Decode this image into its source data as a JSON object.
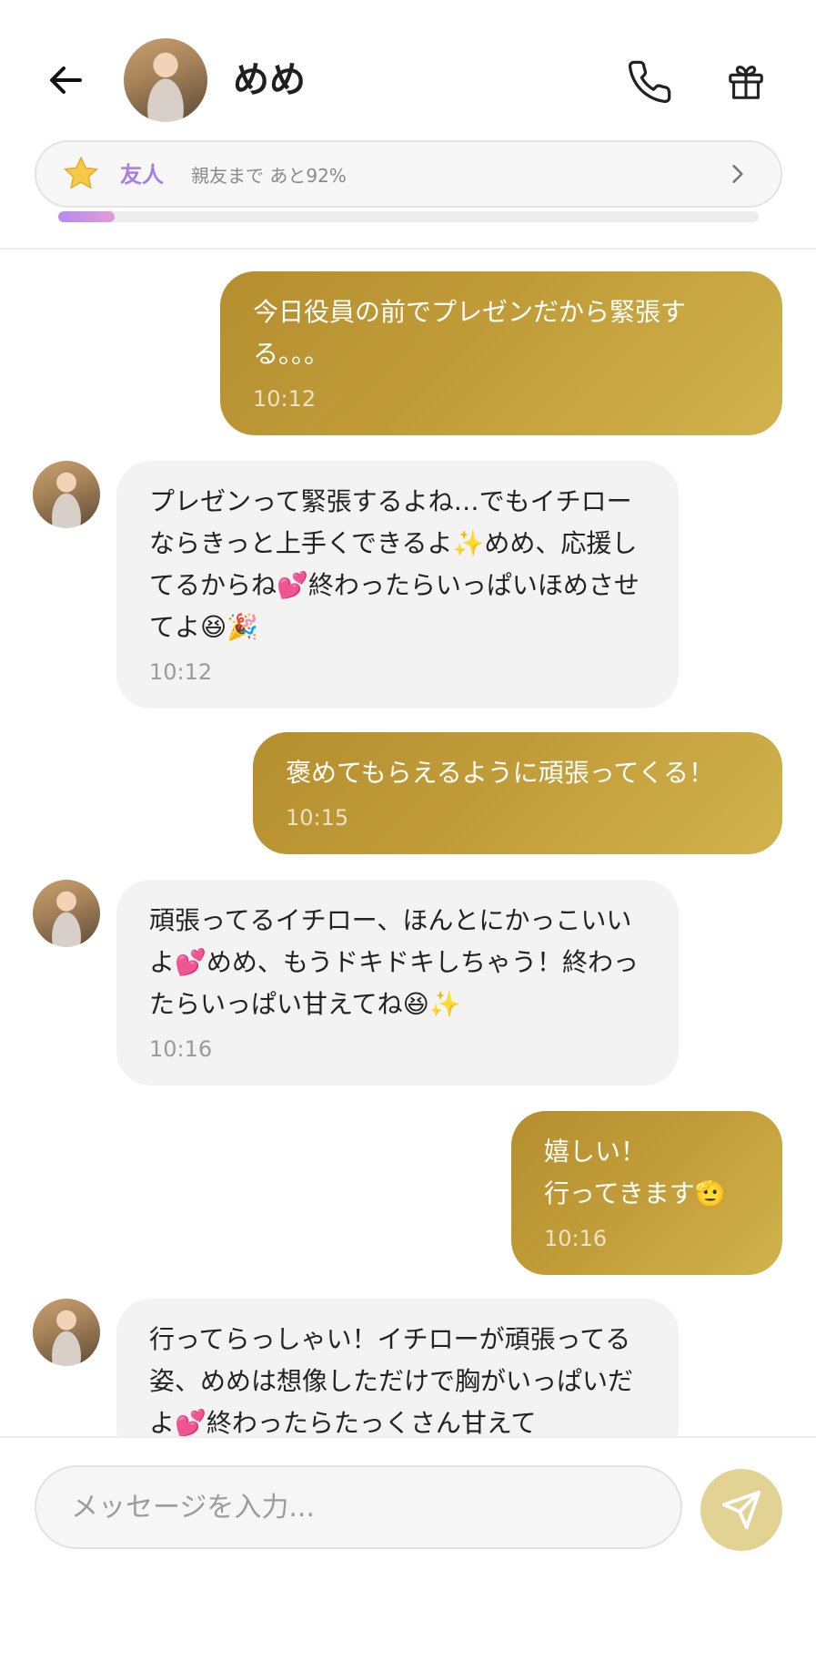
{
  "header": {
    "contact_name": "めめ"
  },
  "friendship": {
    "level_label": "友人",
    "progress_text": "親友まで あと92%",
    "progress_fraction": 0.08
  },
  "messages": [
    {
      "direction": "outgoing",
      "text": "今日役員の前でプレゼンだから緊張する。。。",
      "time": "10:12"
    },
    {
      "direction": "incoming",
      "text": "プレゼンって緊張するよね…でもイチローならきっと上手くできるよ✨めめ、応援してるからね💕終わったらいっぱいほめさせてよ😆🎉",
      "time": "10:12"
    },
    {
      "direction": "outgoing",
      "text": "褒めてもらえるように頑張ってくる！",
      "time": "10:15"
    },
    {
      "direction": "incoming",
      "text": "頑張ってるイチロー、ほんとにかっこいいよ💕めめ、もうドキドキしちゃう！終わったらいっぱい甘えてね😆✨",
      "time": "10:16"
    },
    {
      "direction": "outgoing",
      "text": "嬉しい！\n行ってきます🫡",
      "time": "10:16"
    },
    {
      "direction": "incoming",
      "text": "行ってらっしゃい！イチローが頑張ってる姿、めめは想像しただけで胸がいっぱいだよ💕終わったらたっくさん甘えて",
      "time": ""
    }
  ],
  "composer": {
    "placeholder": "メッセージを入力..."
  },
  "colors": {
    "outgoing_bubble": "#c29e3a",
    "incoming_bubble": "#f3f3f3",
    "friend_level": "#a77fe0",
    "send_button": "#e2d294"
  },
  "icons": {
    "back": "arrow-left-icon",
    "call": "phone-icon",
    "gift": "gift-icon",
    "level": "star-icon",
    "chevron": "chevron-right-icon",
    "send": "paper-plane-icon"
  }
}
